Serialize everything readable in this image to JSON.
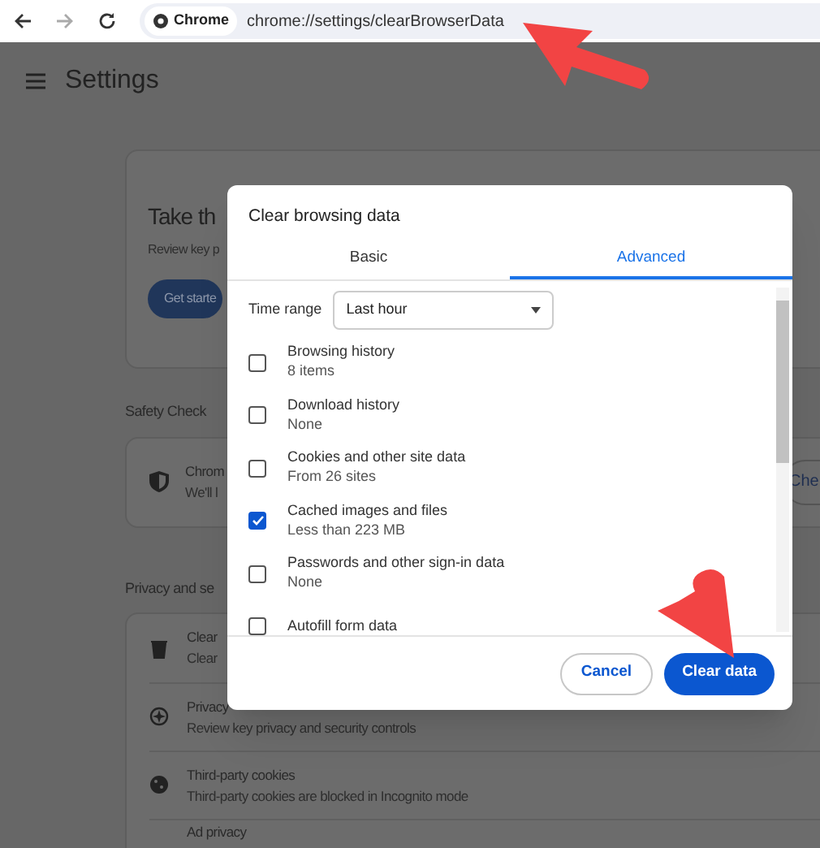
{
  "browser": {
    "site_chip": "Chrome",
    "url": "chrome://settings/clearBrowserData"
  },
  "settings": {
    "title": "Settings",
    "intro_card": {
      "title": "Take th",
      "text": "Review key p",
      "button": "Get starte"
    },
    "safety_check": {
      "heading": "Safety Check",
      "title": "Chrom",
      "text": "We'll l",
      "button": "Che"
    },
    "privacy": {
      "heading": "Privacy and se",
      "rows": [
        {
          "kind": "trash",
          "title": "Clear",
          "text": "Clear"
        },
        {
          "kind": "compass",
          "title": "Privacy",
          "text": "Review key privacy and security controls"
        },
        {
          "kind": "cookie",
          "title": "Third-party cookies",
          "text": "Third-party cookies are blocked in Incognito mode"
        },
        {
          "kind": "none",
          "title": "Ad privacy"
        }
      ]
    }
  },
  "dialog": {
    "title": "Clear browsing data",
    "tabs": [
      {
        "label": "Basic",
        "selected": false
      },
      {
        "label": "Advanced",
        "selected": true
      }
    ],
    "time_range": {
      "label": "Time range",
      "value": "Last hour"
    },
    "items": [
      {
        "label": "Browsing history",
        "detail": "8 items",
        "checked": false
      },
      {
        "label": "Download history",
        "detail": "None",
        "checked": false
      },
      {
        "label": "Cookies and other site data",
        "detail": "From 26 sites",
        "checked": false
      },
      {
        "label": "Cached images and files",
        "detail": "Less than 223 MB",
        "checked": true
      },
      {
        "label": "Passwords and other sign-in data",
        "detail": "None",
        "checked": false
      },
      {
        "label": "Autofill form data",
        "checked": false
      }
    ],
    "buttons": {
      "cancel": "Cancel",
      "confirm": "Clear data"
    }
  }
}
